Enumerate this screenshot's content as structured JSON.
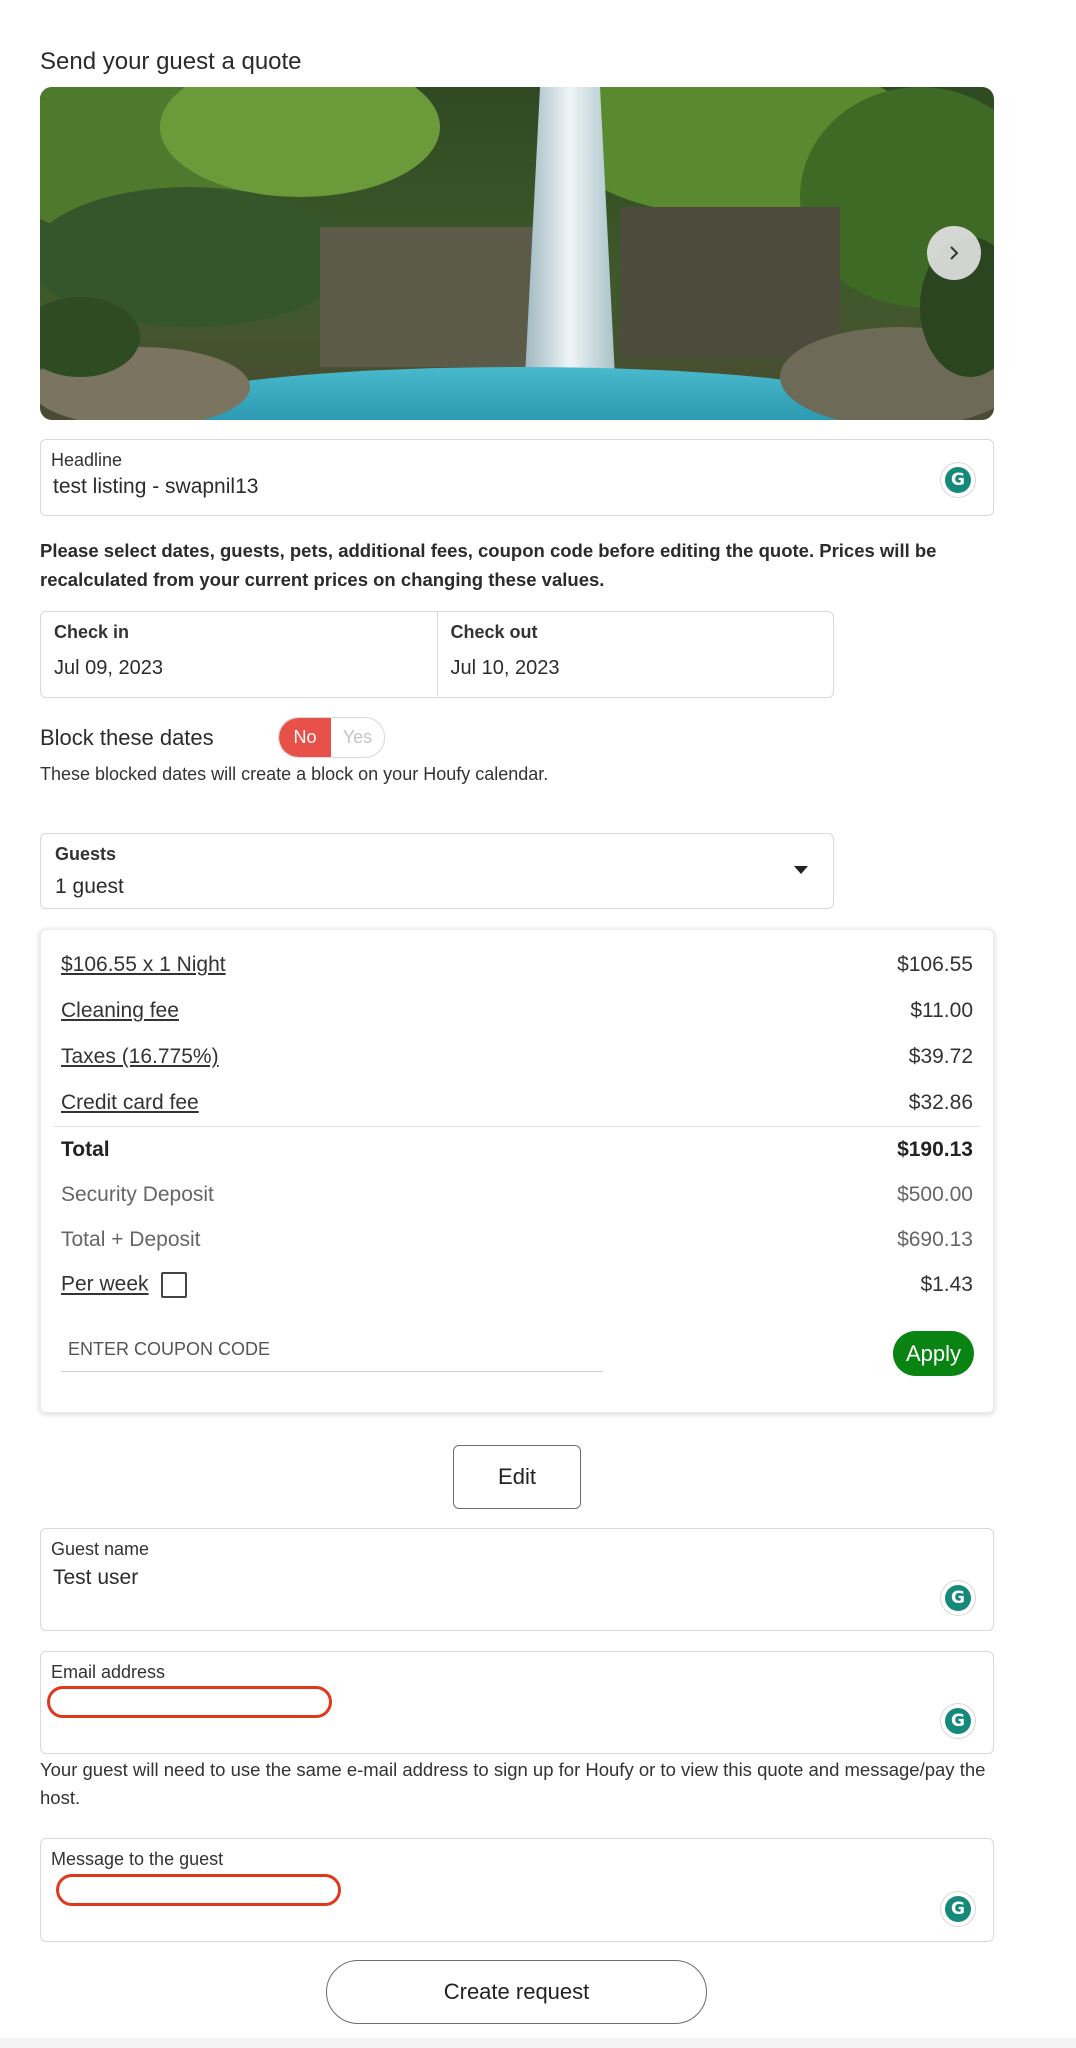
{
  "page": {
    "title": "Send your guest a quote"
  },
  "hero": {
    "next_icon": "chevron-right-icon"
  },
  "headline": {
    "label": "Headline",
    "value": "test listing - swapnil13"
  },
  "notice": "Please select dates, guests, pets, additional fees, coupon code before editing the quote. Prices will be recalculated from your current prices on changing these values.",
  "dates": {
    "checkin_label": "Check in",
    "checkin_value": "Jul 09, 2023",
    "checkout_label": "Check out",
    "checkout_value": "Jul 10, 2023"
  },
  "block": {
    "label": "Block these dates",
    "no": "No",
    "yes": "Yes",
    "selected": "No",
    "help": "These blocked dates will create a block on your Houfy calendar."
  },
  "guests": {
    "label": "Guests",
    "value": "1 guest"
  },
  "pricing": {
    "rows": [
      {
        "label": "$106.55 x 1 Night",
        "amount": "$106.55"
      },
      {
        "label": "Cleaning fee",
        "amount": "$11.00"
      },
      {
        "label": "Taxes (16.775%)",
        "amount": "$39.72"
      },
      {
        "label": "Credit card fee",
        "amount": "$32.86"
      }
    ],
    "total": {
      "label": "Total",
      "amount": "$190.13"
    },
    "deposit": {
      "label": "Security Deposit",
      "amount": "$500.00"
    },
    "total_deposit": {
      "label": "Total + Deposit",
      "amount": "$690.13"
    },
    "per_week": {
      "label": "Per week",
      "amount": "$1.43",
      "checked": false
    },
    "coupon_placeholder": "ENTER COUPON CODE",
    "apply_label": "Apply"
  },
  "edit_label": "Edit",
  "guest_name": {
    "label": "Guest name",
    "value": "Test user"
  },
  "email": {
    "label": "Email address",
    "value": ""
  },
  "email_help": "Your guest will need to use the same e-mail address to sign up for Houfy or to view this quote and message/pay the host.",
  "message": {
    "label": "Message to the guest",
    "value": ""
  },
  "create_label": "Create request",
  "colors": {
    "accent_red": "#e8504a",
    "apply_green": "#098412",
    "annotation_red": "#e0381c",
    "grammarly": "#15897a"
  }
}
